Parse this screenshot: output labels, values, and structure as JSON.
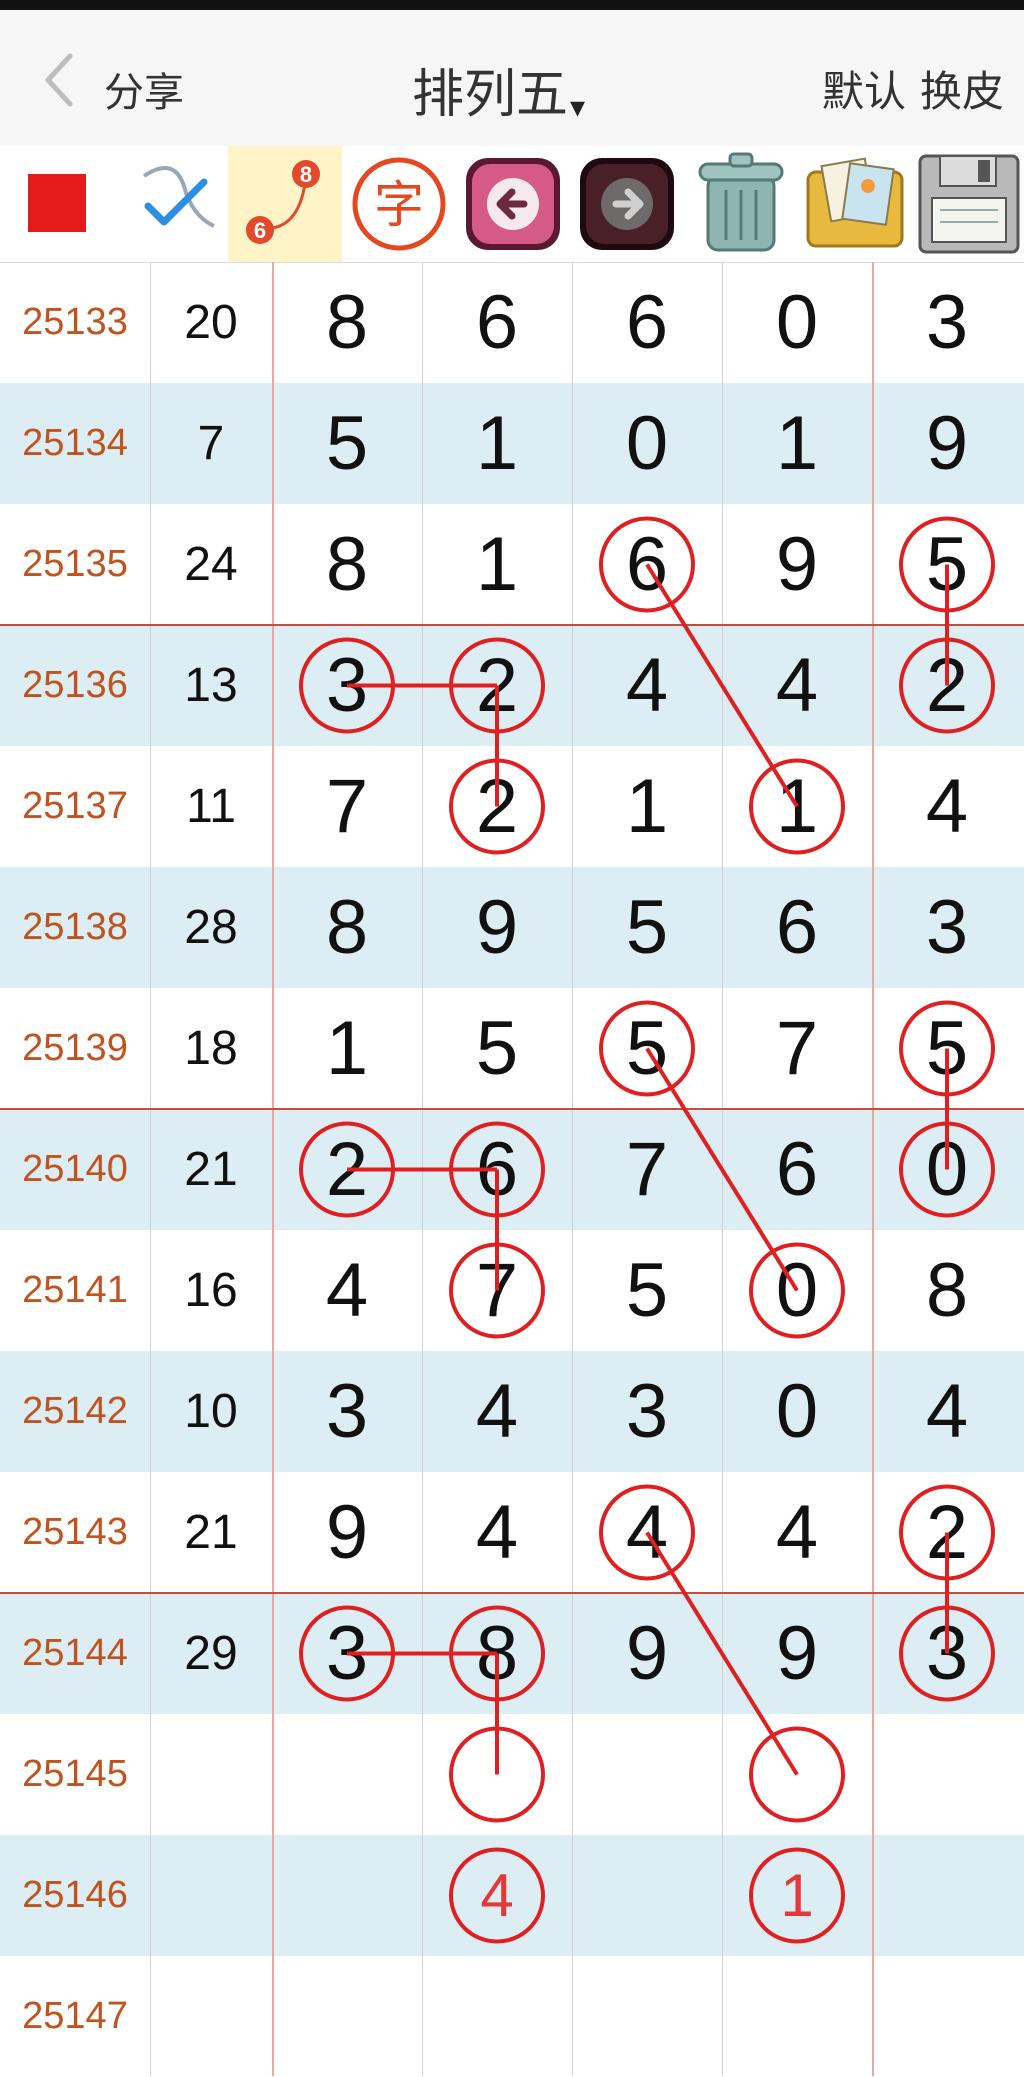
{
  "header": {
    "back_icon": "chevron-left-icon",
    "share_label": "分享",
    "title": "排列五",
    "title_caret": "▾",
    "default_label": "默认",
    "skin_label": "换皮"
  },
  "toolbar": {
    "tools": [
      {
        "icon": "red-square-icon"
      },
      {
        "icon": "checkmark-pen-icon"
      },
      {
        "icon": "connect-line-icon",
        "badge_top": "8",
        "badge_bottom": "6"
      },
      {
        "icon": "text-tool-icon",
        "glyph": "字"
      },
      {
        "icon": "undo-arrow-icon"
      },
      {
        "icon": "redo-arrow-icon"
      },
      {
        "icon": "trash-icon"
      },
      {
        "icon": "photo-album-icon"
      },
      {
        "icon": "floppy-save-icon"
      }
    ]
  },
  "accent_color": "#e02020",
  "alt_row_color": "#dcedf4",
  "rows": [
    {
      "issue": "25133",
      "sum": "20",
      "digits": [
        "8",
        "6",
        "6",
        "0",
        "3"
      ]
    },
    {
      "issue": "25134",
      "sum": "7",
      "digits": [
        "5",
        "1",
        "0",
        "1",
        "9"
      ]
    },
    {
      "issue": "25135",
      "sum": "24",
      "digits": [
        "8",
        "1",
        "6",
        "9",
        "5"
      ]
    },
    {
      "issue": "25136",
      "sum": "13",
      "digits": [
        "3",
        "2",
        "4",
        "4",
        "2"
      ]
    },
    {
      "issue": "25137",
      "sum": "11",
      "digits": [
        "7",
        "2",
        "1",
        "1",
        "4"
      ]
    },
    {
      "issue": "25138",
      "sum": "28",
      "digits": [
        "8",
        "9",
        "5",
        "6",
        "3"
      ]
    },
    {
      "issue": "25139",
      "sum": "18",
      "digits": [
        "1",
        "5",
        "5",
        "7",
        "5"
      ]
    },
    {
      "issue": "25140",
      "sum": "21",
      "digits": [
        "2",
        "6",
        "7",
        "6",
        "0"
      ]
    },
    {
      "issue": "25141",
      "sum": "16",
      "digits": [
        "4",
        "7",
        "5",
        "0",
        "8"
      ]
    },
    {
      "issue": "25142",
      "sum": "10",
      "digits": [
        "3",
        "4",
        "3",
        "0",
        "4"
      ]
    },
    {
      "issue": "25143",
      "sum": "21",
      "digits": [
        "9",
        "4",
        "4",
        "4",
        "2"
      ]
    },
    {
      "issue": "25144",
      "sum": "29",
      "digits": [
        "3",
        "8",
        "9",
        "9",
        "3"
      ]
    },
    {
      "issue": "25145",
      "sum": "",
      "digits": [
        "",
        "",
        "",
        "",
        ""
      ]
    },
    {
      "issue": "25146",
      "sum": "",
      "digits": [
        "",
        "4",
        "",
        "1",
        ""
      ]
    },
    {
      "issue": "25147",
      "sum": "",
      "digits": [
        "",
        "",
        "",
        "",
        ""
      ]
    }
  ],
  "circles": [
    {
      "row": 2,
      "col": 2
    },
    {
      "row": 2,
      "col": 4
    },
    {
      "row": 3,
      "col": 0
    },
    {
      "row": 3,
      "col": 1
    },
    {
      "row": 3,
      "col": 4
    },
    {
      "row": 4,
      "col": 1
    },
    {
      "row": 4,
      "col": 3
    },
    {
      "row": 6,
      "col": 2
    },
    {
      "row": 6,
      "col": 4
    },
    {
      "row": 7,
      "col": 0
    },
    {
      "row": 7,
      "col": 1
    },
    {
      "row": 7,
      "col": 4
    },
    {
      "row": 8,
      "col": 1
    },
    {
      "row": 8,
      "col": 3
    },
    {
      "row": 10,
      "col": 2
    },
    {
      "row": 10,
      "col": 4
    },
    {
      "row": 11,
      "col": 0
    },
    {
      "row": 11,
      "col": 1
    },
    {
      "row": 11,
      "col": 4
    },
    {
      "row": 12,
      "col": 1
    },
    {
      "row": 12,
      "col": 3
    },
    {
      "row": 13,
      "col": 1
    },
    {
      "row": 13,
      "col": 3
    }
  ],
  "lines": [
    {
      "from": {
        "row": 3,
        "col": 0
      },
      "to": {
        "row": 3,
        "col": 1
      }
    },
    {
      "from": {
        "row": 3,
        "col": 1
      },
      "to": {
        "row": 4,
        "col": 1
      }
    },
    {
      "from": {
        "row": 2,
        "col": 2
      },
      "to": {
        "row": 4,
        "col": 3
      }
    },
    {
      "from": {
        "row": 2,
        "col": 4
      },
      "to": {
        "row": 3,
        "col": 4
      }
    },
    {
      "from": {
        "row": 7,
        "col": 0
      },
      "to": {
        "row": 7,
        "col": 1
      }
    },
    {
      "from": {
        "row": 7,
        "col": 1
      },
      "to": {
        "row": 8,
        "col": 1
      }
    },
    {
      "from": {
        "row": 6,
        "col": 2
      },
      "to": {
        "row": 8,
        "col": 3
      }
    },
    {
      "from": {
        "row": 6,
        "col": 4
      },
      "to": {
        "row": 7,
        "col": 4
      }
    },
    {
      "from": {
        "row": 11,
        "col": 0
      },
      "to": {
        "row": 11,
        "col": 1
      }
    },
    {
      "from": {
        "row": 11,
        "col": 1
      },
      "to": {
        "row": 12,
        "col": 1
      }
    },
    {
      "from": {
        "row": 10,
        "col": 2
      },
      "to": {
        "row": 12,
        "col": 3
      }
    },
    {
      "from": {
        "row": 10,
        "col": 4
      },
      "to": {
        "row": 11,
        "col": 4
      }
    }
  ],
  "group_separators_after_rows": [
    2,
    6,
    10
  ]
}
